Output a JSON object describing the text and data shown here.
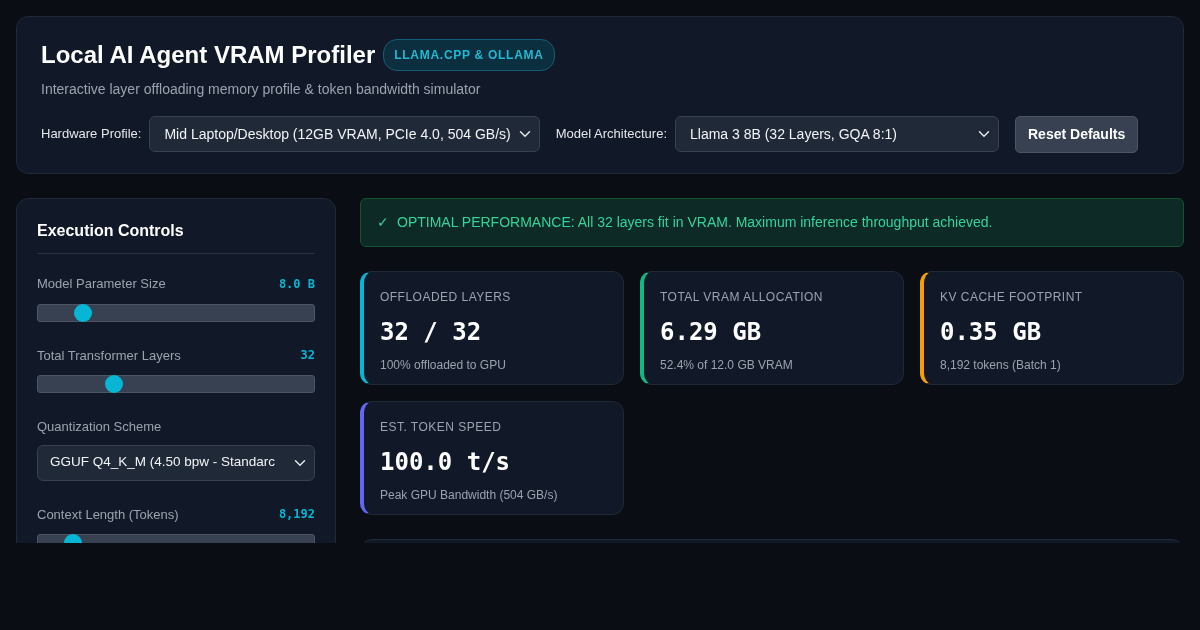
{
  "header": {
    "title": "Local AI Agent VRAM Profiler",
    "badge": "LLAMA.CPP & OLLAMA",
    "subtitle": "Interactive layer offloading memory profile & token bandwidth simulator",
    "controls": [
      {
        "kind": "select",
        "label": "Hardware Profile:",
        "value": "Mid Laptop/Desktop (12GB VRAM, PCIe 4.0, 504 GB/s)"
      },
      {
        "kind": "select",
        "label": "Model Architecture:",
        "value": "Llama 3 8B (32 Layers, GQA 8:1)"
      },
      {
        "kind": "button",
        "label": "Reset Defaults"
      }
    ]
  },
  "sidebar": {
    "title": "Execution Controls",
    "items": [
      {
        "kind": "slider",
        "label": "Model Parameter Size",
        "reading": "8.0 B",
        "level": 0.14
      },
      {
        "kind": "slider",
        "label": "Total Transformer Layers",
        "reading": "32",
        "level": 0.26
      },
      {
        "kind": "select",
        "label": "Quantization Scheme",
        "value": "GGUF Q4_K_M (4.50 bpw - Standarc"
      },
      {
        "kind": "slider",
        "label": "Context Length (Tokens)",
        "reading": "8,192",
        "level": 0.1
      }
    ]
  },
  "alert": {
    "icon": "✓",
    "text": "OPTIMAL PERFORMANCE: All 32 layers fit in VRAM. Maximum inference throughput achieved."
  },
  "stats": [
    {
      "label": "OFFLOADED LAYERS",
      "value": "32 / 32",
      "note": "100% offloaded to GPU",
      "color": "#06b6d4"
    },
    {
      "label": "TOTAL VRAM ALLOCATION",
      "value": "6.29 GB",
      "note": "52.4% of 12.0 GB VRAM",
      "color": "#10b981"
    },
    {
      "label": "KV CACHE FOOTPRINT",
      "value": "0.35 GB",
      "note": "8,192 tokens (Batch 1)",
      "color": "#f59e0b"
    },
    {
      "label": "EST. TOKEN SPEED",
      "value": "100.0 t/s",
      "note": "Peak GPU Bandwidth (504 GB/s)",
      "color": "#6366f1"
    }
  ]
}
